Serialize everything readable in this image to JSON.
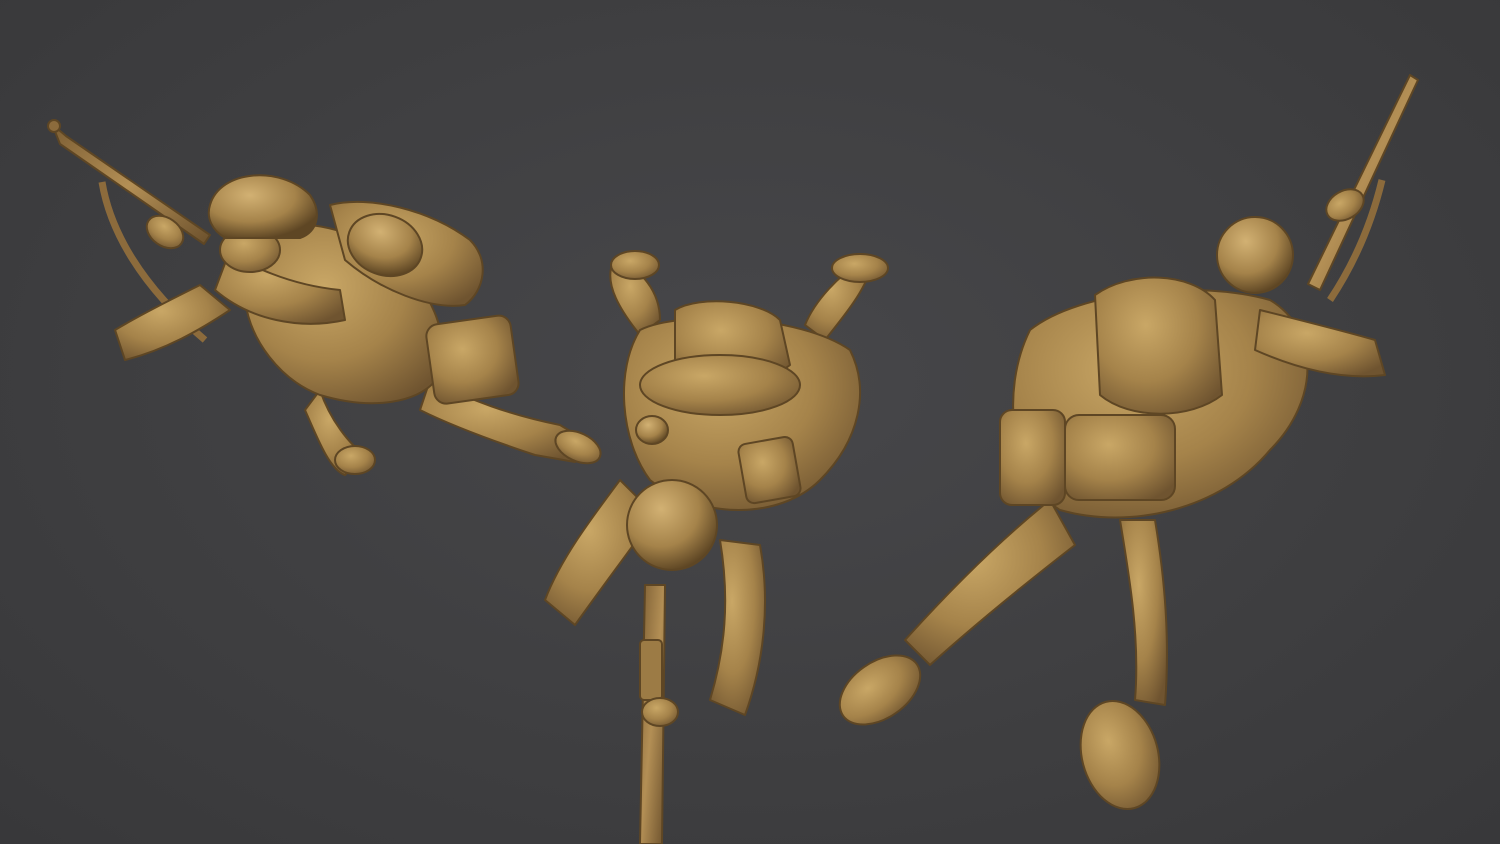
{
  "scene": {
    "background_color": "#3f3f41",
    "model_color": "#a5834a",
    "model_highlight": "#c9a766",
    "model_shadow": "#5e4624",
    "figures": [
      {
        "name": "left-soldier"
      },
      {
        "name": "center-soldier"
      },
      {
        "name": "right-soldier"
      }
    ]
  }
}
